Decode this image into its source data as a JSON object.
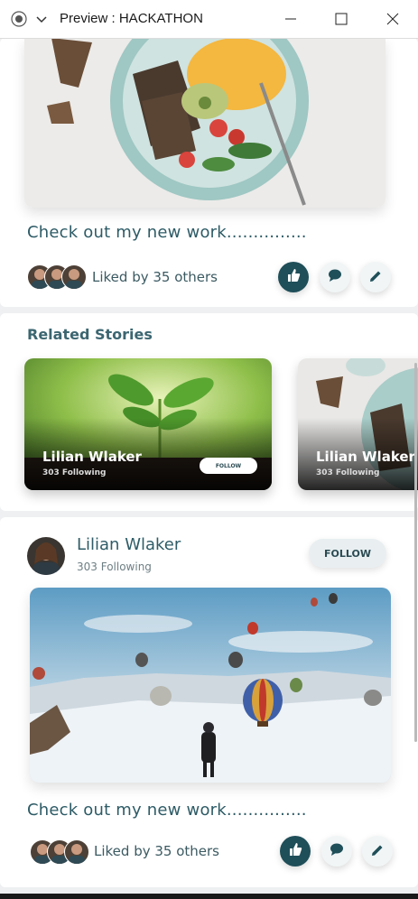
{
  "window": {
    "title": "Preview : HACKATHON",
    "icons": [
      "record-icon",
      "chevron-down-icon",
      "minimize-icon",
      "maximize-icon",
      "close-icon"
    ]
  },
  "posts": [
    {
      "image": "food-bowl-photo",
      "caption": "Check out my new work...............",
      "liked_by": "Liked by 35 others"
    },
    {
      "image": "hot-air-balloons-photo",
      "caption": "Check out my new work...............",
      "liked_by": "Liked by 35 others",
      "author": {
        "name": "Lilian Wlaker",
        "following": "303 Following",
        "follow_label": "FOLLOW"
      }
    }
  ],
  "related": {
    "title": "Related Stories",
    "stories": [
      {
        "name": "Lilian Wlaker",
        "following": "303 Following",
        "button": "FOLLOW",
        "image": "plant-sprout-photo"
      },
      {
        "name": "Lilian Wlaker",
        "following": "303 Following",
        "image": "food-bowl-photo"
      }
    ]
  },
  "actions": [
    "thumbs-up-icon",
    "comment-icon",
    "edit-icon"
  ],
  "colors": {
    "accent": "#1f4f59",
    "text": "#2d5b66",
    "background": "#eef0f1"
  }
}
